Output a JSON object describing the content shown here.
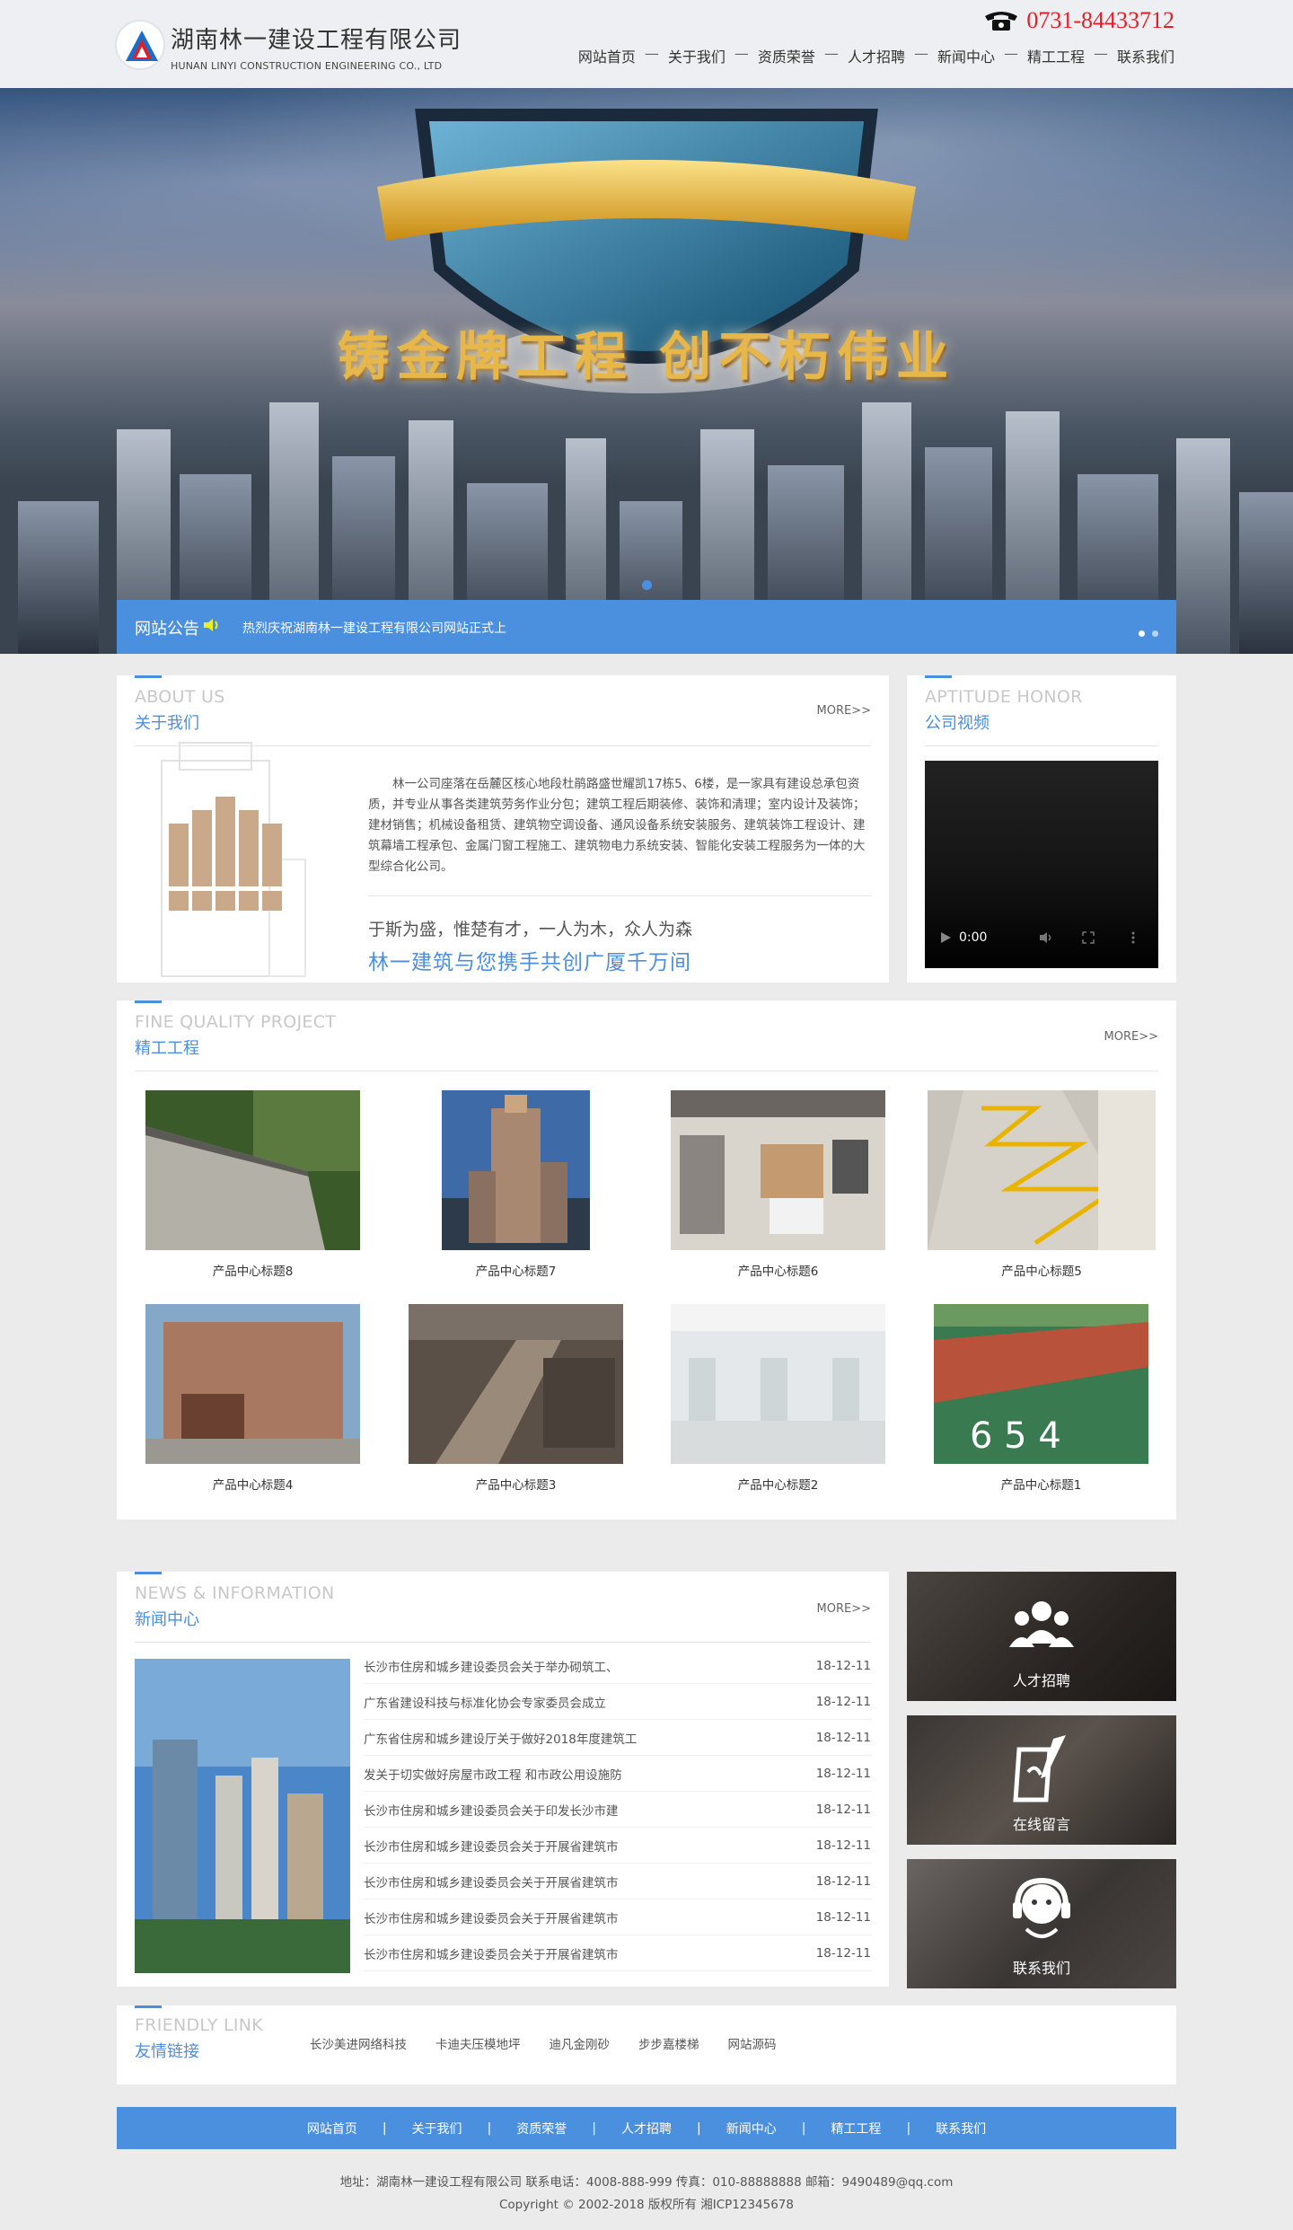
{
  "header": {
    "company_cn": "湖南林一建设工程有限公司",
    "company_en": "HUNAN LINYI CONSTRUCTION ENGINEERING CO., LTD",
    "phone": "0731-84433712",
    "nav": [
      "网站首页",
      "关于我们",
      "资质荣誉",
      "人才招聘",
      "新闻中心",
      "精工工程",
      "联系我们"
    ],
    "nav_sep": "—"
  },
  "banner": {
    "slogan": "铸金牌工程  创不朽伟业"
  },
  "notice": {
    "label": "网站公告",
    "message": "热烈庆祝湖南林一建设工程有限公司网站正式上"
  },
  "about": {
    "title_en": "ABOUT US",
    "title_cn": "关于我们",
    "more": "MORE>>",
    "text": "林一公司座落在岳麓区核心地段杜鹃路盛世耀凯17栋5、6楼，是一家具有建设总承包资质，并专业从事各类建筑劳务作业分包；建筑工程后期装修、装饰和清理；室内设计及装饰；建材销售；机械设备租赁、建筑物空调设备、通风设备系统安装服务、建筑装饰工程设计、建筑幕墙工程承包、金属门窗工程施工、建筑物电力系统安装、智能化安装工程服务为一体的大型综合化公司。",
    "motto1": "于斯为盛，惟楚有才，一人为木，众人为森",
    "motto2": "林一建筑与您携手共创广厦千万间"
  },
  "honor": {
    "title_en": "APTITUDE HONOR",
    "title_cn": "公司视频",
    "video_time": "0:00"
  },
  "projects": {
    "title_en": "FINE QUALITY PROJECT",
    "title_cn": "精工工程",
    "more": "MORE>>",
    "items": [
      "产品中心标题8",
      "产品中心标题7",
      "产品中心标题6",
      "产品中心标题5",
      "产品中心标题4",
      "产品中心标题3",
      "产品中心标题2",
      "产品中心标题1"
    ]
  },
  "news": {
    "title_en": "NEWS & INFORMATION",
    "title_cn": "新闻中心",
    "more": "MORE>>",
    "items": [
      {
        "title": "长沙市住房和城乡建设委员会关于举办砌筑工、",
        "date": "18-12-11"
      },
      {
        "title": "广东省建设科技与标准化协会专家委员会成立",
        "date": "18-12-11"
      },
      {
        "title": "广东省住房和城乡建设厅关于做好2018年度建筑工",
        "date": "18-12-11"
      },
      {
        "title": "发关于切实做好房屋市政工程 和市政公用设施防",
        "date": "18-12-11"
      },
      {
        "title": "长沙市住房和城乡建设委员会关于印发长沙市建",
        "date": "18-12-11"
      },
      {
        "title": "长沙市住房和城乡建设委员会关于开展省建筑市",
        "date": "18-12-11"
      },
      {
        "title": "长沙市住房和城乡建设委员会关于开展省建筑市",
        "date": "18-12-11"
      },
      {
        "title": "长沙市住房和城乡建设委员会关于开展省建筑市",
        "date": "18-12-11"
      },
      {
        "title": "长沙市住房和城乡建设委员会关于开展省建筑市",
        "date": "18-12-11"
      }
    ]
  },
  "side": [
    "人才招聘",
    "在线留言",
    "联系我们"
  ],
  "links": {
    "title_en": "FRIENDLY LINK",
    "title_cn": "友情链接",
    "items": [
      "长沙美进网络科技",
      "卡迪夫压模地坪",
      "迪凡金刚砂",
      "步步嘉楼梯",
      "网站源码"
    ]
  },
  "footer": {
    "nav": [
      "网站首页",
      "关于我们",
      "资质荣誉",
      "人才招聘",
      "新闻中心",
      "精工工程",
      "联系我们"
    ],
    "sep": "|",
    "address": "地址：湖南林一建设工程有限公司  联系电话：4008-888-999  传真：010-88888888  邮箱：9490489@qq.com",
    "copyright": "Copyright © 2002-2018 版权所有     湘ICP12345678"
  }
}
